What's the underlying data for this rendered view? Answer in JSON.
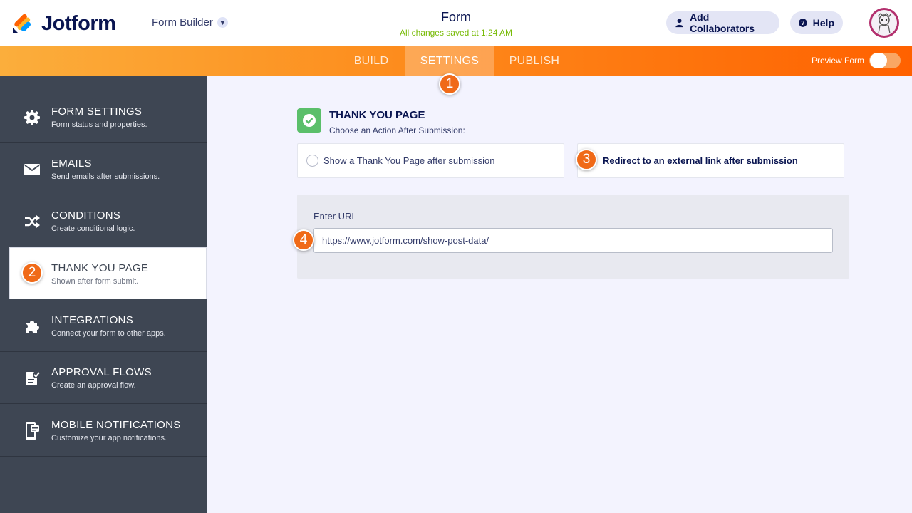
{
  "header": {
    "logo_text": "Jotform",
    "builder_label": "Form Builder",
    "form_title": "Form",
    "saved_status": "All changes saved at 1:24 AM",
    "collaborators_label": "Add Collaborators",
    "help_label": "Help"
  },
  "tabs": [
    {
      "label": "BUILD",
      "active": false
    },
    {
      "label": "SETTINGS",
      "active": true
    },
    {
      "label": "PUBLISH",
      "active": false
    }
  ],
  "preview": {
    "label": "Preview Form",
    "enabled": false
  },
  "sidebar": {
    "items": [
      {
        "title": "FORM SETTINGS",
        "subtitle": "Form status and properties.",
        "icon": "gear-icon"
      },
      {
        "title": "EMAILS",
        "subtitle": "Send emails after submissions.",
        "icon": "envelope-icon"
      },
      {
        "title": "CONDITIONS",
        "subtitle": "Create conditional logic.",
        "icon": "shuffle-icon"
      },
      {
        "title": "THANK YOU PAGE",
        "subtitle": "Shown after form submit.",
        "icon": "thank-you-icon",
        "active": true
      },
      {
        "title": "INTEGRATIONS",
        "subtitle": "Connect your form to other apps.",
        "icon": "puzzle-icon"
      },
      {
        "title": "APPROVAL FLOWS",
        "subtitle": "Create an approval flow.",
        "icon": "approval-icon"
      },
      {
        "title": "MOBILE NOTIFICATIONS",
        "subtitle": "Customize your app notifications.",
        "icon": "mobile-icon"
      }
    ]
  },
  "thank_you": {
    "title": "THANK YOU PAGE",
    "subtitle": "Choose an Action After Submission:",
    "options": [
      {
        "label": "Show a Thank You Page after submission",
        "selected": false
      },
      {
        "label": "Redirect to an external link after submission",
        "selected": true
      }
    ],
    "url_label": "Enter URL",
    "url_value": "https://www.jotform.com/show-post-data/"
  },
  "badges": [
    "1",
    "2",
    "3",
    "4"
  ],
  "colors": {
    "accent_orange": "#ff6100",
    "sidebar_bg": "#3e4653",
    "badge": "#f06a18",
    "success_green": "#5bbf6a",
    "saved_text": "#78bb07"
  }
}
